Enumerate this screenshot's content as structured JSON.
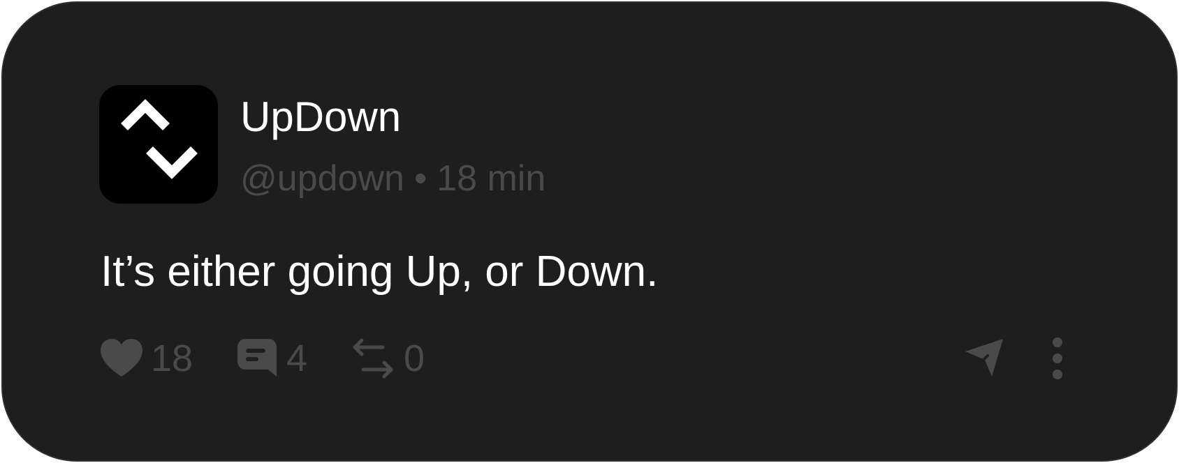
{
  "post": {
    "account": {
      "display_name": "UpDown",
      "handle": "@updown",
      "separator": "•",
      "time_ago": "18 min",
      "avatar_icon": "updown-logo-icon"
    },
    "text": "It’s either going Up, or Down.",
    "actions": {
      "likes": "18",
      "comments": "4",
      "reposts": "0"
    },
    "icons": {
      "like": "heart-icon",
      "comment": "comment-bubble-icon",
      "repost": "repost-arrows-icon",
      "share": "send-icon",
      "more": "more-vertical-icon"
    },
    "colors": {
      "background": "#1e1e1e",
      "text_primary": "#ffffff",
      "text_muted": "#4a4a4a"
    }
  }
}
